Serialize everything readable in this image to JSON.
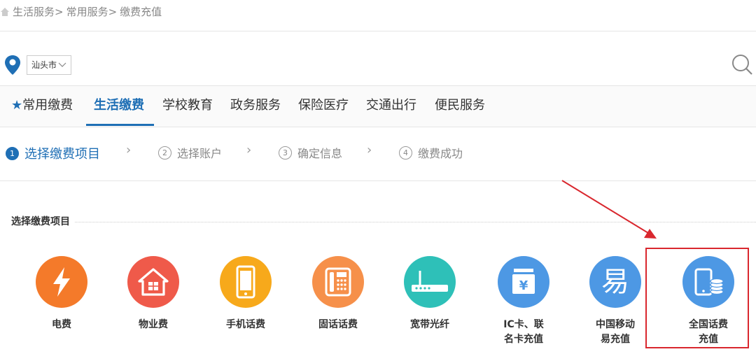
{
  "breadcrumb": {
    "items": [
      "生活服务>",
      "常用服务>",
      "缴费充值"
    ]
  },
  "location": {
    "city": "汕头市"
  },
  "tabs": [
    {
      "label": "常用缴费",
      "active": false
    },
    {
      "label": "生活缴费",
      "active": true
    },
    {
      "label": "学校教育",
      "active": false
    },
    {
      "label": "政务服务",
      "active": false
    },
    {
      "label": "保险医疗",
      "active": false
    },
    {
      "label": "交通出行",
      "active": false
    },
    {
      "label": "便民服务",
      "active": false
    }
  ],
  "steps": [
    {
      "num": "1",
      "label": "选择缴费项目",
      "active": true
    },
    {
      "num": "2",
      "label": "选择账户",
      "active": false
    },
    {
      "num": "3",
      "label": "确定信息",
      "active": false
    },
    {
      "num": "4",
      "label": "缴费成功",
      "active": false
    }
  ],
  "section": {
    "title": "选择缴费项目"
  },
  "items": [
    {
      "line1": "电费",
      "line2": "",
      "icon": "lightning-icon",
      "color": "#f47a2a"
    },
    {
      "line1": "物业费",
      "line2": "",
      "icon": "house-icon",
      "color": "#ef5a4a"
    },
    {
      "line1": "手机话费",
      "line2": "",
      "icon": "mobile-phone-icon",
      "color": "#f7a91b"
    },
    {
      "line1": "固话话费",
      "line2": "",
      "icon": "landline-phone-icon",
      "color": "#f6904a"
    },
    {
      "line1": "宽带光纤",
      "line2": "",
      "icon": "router-icon",
      "color": "#2ec0b8"
    },
    {
      "line1": "IC卡、联",
      "line2": "名卡充值",
      "icon": "yuan-card-icon",
      "color": "#4d98e4"
    },
    {
      "line1": "中国移动",
      "line2": "易充值",
      "icon": "yi-character-icon",
      "color": "#4d98e4",
      "glyph": "易"
    },
    {
      "line1": "全国话费",
      "line2": "充值",
      "icon": "phone-coins-icon",
      "color": "#4d98e4"
    }
  ],
  "colors": {
    "accent": "#1f6fb5",
    "highlight": "#d9272e"
  }
}
